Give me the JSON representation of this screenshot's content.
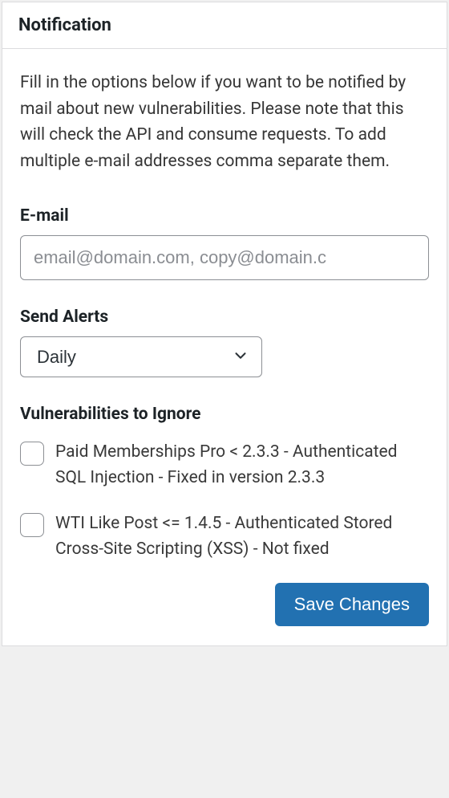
{
  "panel": {
    "title": "Notification",
    "intro": "Fill in the options below if you want to be notified by mail about new vulnerabilities. Please note that this will check the API and consume requests. To add multiple e-mail addresses comma separate them."
  },
  "email": {
    "label": "E-mail",
    "value": "",
    "placeholder": "email@domain.com, copy@domain.c"
  },
  "alerts": {
    "label": "Send Alerts",
    "selected": "Daily",
    "options": [
      "Daily"
    ]
  },
  "ignore": {
    "label": "Vulnerabilities to Ignore",
    "items": [
      {
        "checked": false,
        "label": "Paid Memberships Pro < 2.3.3 - Authenticated SQL Injection - Fixed in version 2.3.3"
      },
      {
        "checked": false,
        "label": "WTI Like Post <= 1.4.5 - Authenticated Stored Cross-Site Scripting (XSS) - Not fixed"
      }
    ]
  },
  "actions": {
    "save_label": "Save Changes"
  }
}
